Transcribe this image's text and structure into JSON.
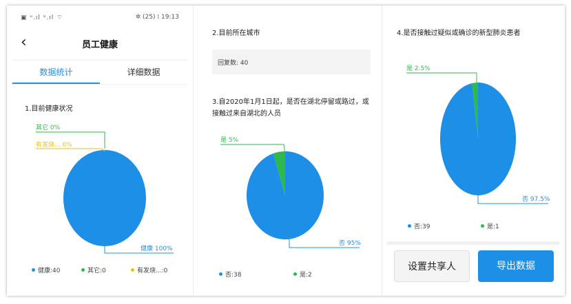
{
  "status_bar": {
    "left": "▣ ᵘ.ıl ᵘ.ıl ⌔",
    "right": "✲ (25) ⁞ 19:13"
  },
  "header": {
    "back": "‹",
    "title": "员工健康"
  },
  "tabs": [
    {
      "label": "数据统计",
      "active": true
    },
    {
      "label": "详细数据",
      "active": false
    }
  ],
  "colors": {
    "blue": "#1e8fe6",
    "green": "#2fb84e",
    "yellow": "#e6c31a"
  },
  "sections": {
    "q1": {
      "title": "1.目前健康状况",
      "labels": {
        "other": "其它 0%",
        "fever": "有发烧... 0%",
        "healthy": "健康 100%"
      },
      "legend": [
        {
          "text": "健康:40",
          "color": "#1e8fe6"
        },
        {
          "text": "其它:0",
          "color": "#2fb84e"
        },
        {
          "text": "有发烧...:0",
          "color": "#e6c31a"
        }
      ]
    },
    "q2": {
      "title": "2.目前所在城市",
      "reply_count": "回复数: 40"
    },
    "q3": {
      "title": "3.自2020年1月1日起，是否在湖北停留或路过，或接触过来自湖北的人员",
      "labels": {
        "yes": "是 5%",
        "no": "否 95%"
      },
      "legend": [
        {
          "text": "否:38",
          "color": "#1e8fe6"
        },
        {
          "text": "是:2",
          "color": "#2fb84e"
        }
      ]
    },
    "q4": {
      "title": "4.是否接触过疑似或确诊的新型肺炎患者",
      "labels": {
        "yes": "是 2.5%",
        "no": "否 97.5%"
      },
      "legend": [
        {
          "text": "否:39",
          "color": "#1e8fe6"
        },
        {
          "text": "是:1",
          "color": "#2fb84e"
        }
      ]
    }
  },
  "chart_data": [
    {
      "type": "pie",
      "title": "1.目前健康状况",
      "categories": [
        "健康",
        "其它",
        "有发烧..."
      ],
      "values": [
        40,
        0,
        0
      ],
      "percent": [
        100,
        0,
        0
      ]
    },
    {
      "type": "pie",
      "title": "3.自2020年1月1日起，是否在湖北停留或路过，或接触过来自湖北的人员",
      "categories": [
        "否",
        "是"
      ],
      "values": [
        38,
        2
      ],
      "percent": [
        95,
        5
      ]
    },
    {
      "type": "pie",
      "title": "4.是否接触过疑似或确诊的新型肺炎患者",
      "categories": [
        "否",
        "是"
      ],
      "values": [
        39,
        1
      ],
      "percent": [
        97.5,
        2.5
      ]
    }
  ],
  "buttons": {
    "share": "设置共享人",
    "export": "导出数据"
  }
}
